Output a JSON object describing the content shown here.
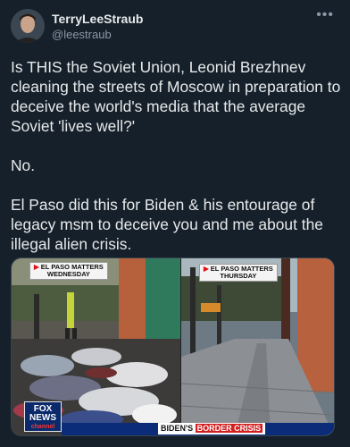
{
  "author": {
    "display_name": "TerryLeeStraub",
    "handle": "@leestraub"
  },
  "menu": {
    "more_label": "•••"
  },
  "tweet": {
    "text": "Is THIS the Soviet Union, Leonid Brezhnev cleaning the streets of Moscow in preparation to deceive the world's media that the average Soviet 'lives well?'\n\nNo.\n\nEl Paso did this for Biden & his entourage of legacy msm to deceive you and me about the illegal alien crisis."
  },
  "media": {
    "left_tag": {
      "line1": "EL PASO MATTERS",
      "line2": "WEDNESDAY"
    },
    "right_tag": {
      "line1": "EL PASO MATTERS",
      "line2": "THURSDAY"
    },
    "network_logo": {
      "line1": "FOX",
      "line2": "NEWS",
      "line3": "channel"
    },
    "chyron": {
      "prefix": "BIDEN'S",
      "highlight": "BORDER CRISIS"
    }
  },
  "colors": {
    "background": "#15202b",
    "primary_text": "#e7e9ea",
    "secondary_text": "#8b98a5",
    "chyron_red": "#d41e1e",
    "fox_blue": "#0b2c79"
  }
}
